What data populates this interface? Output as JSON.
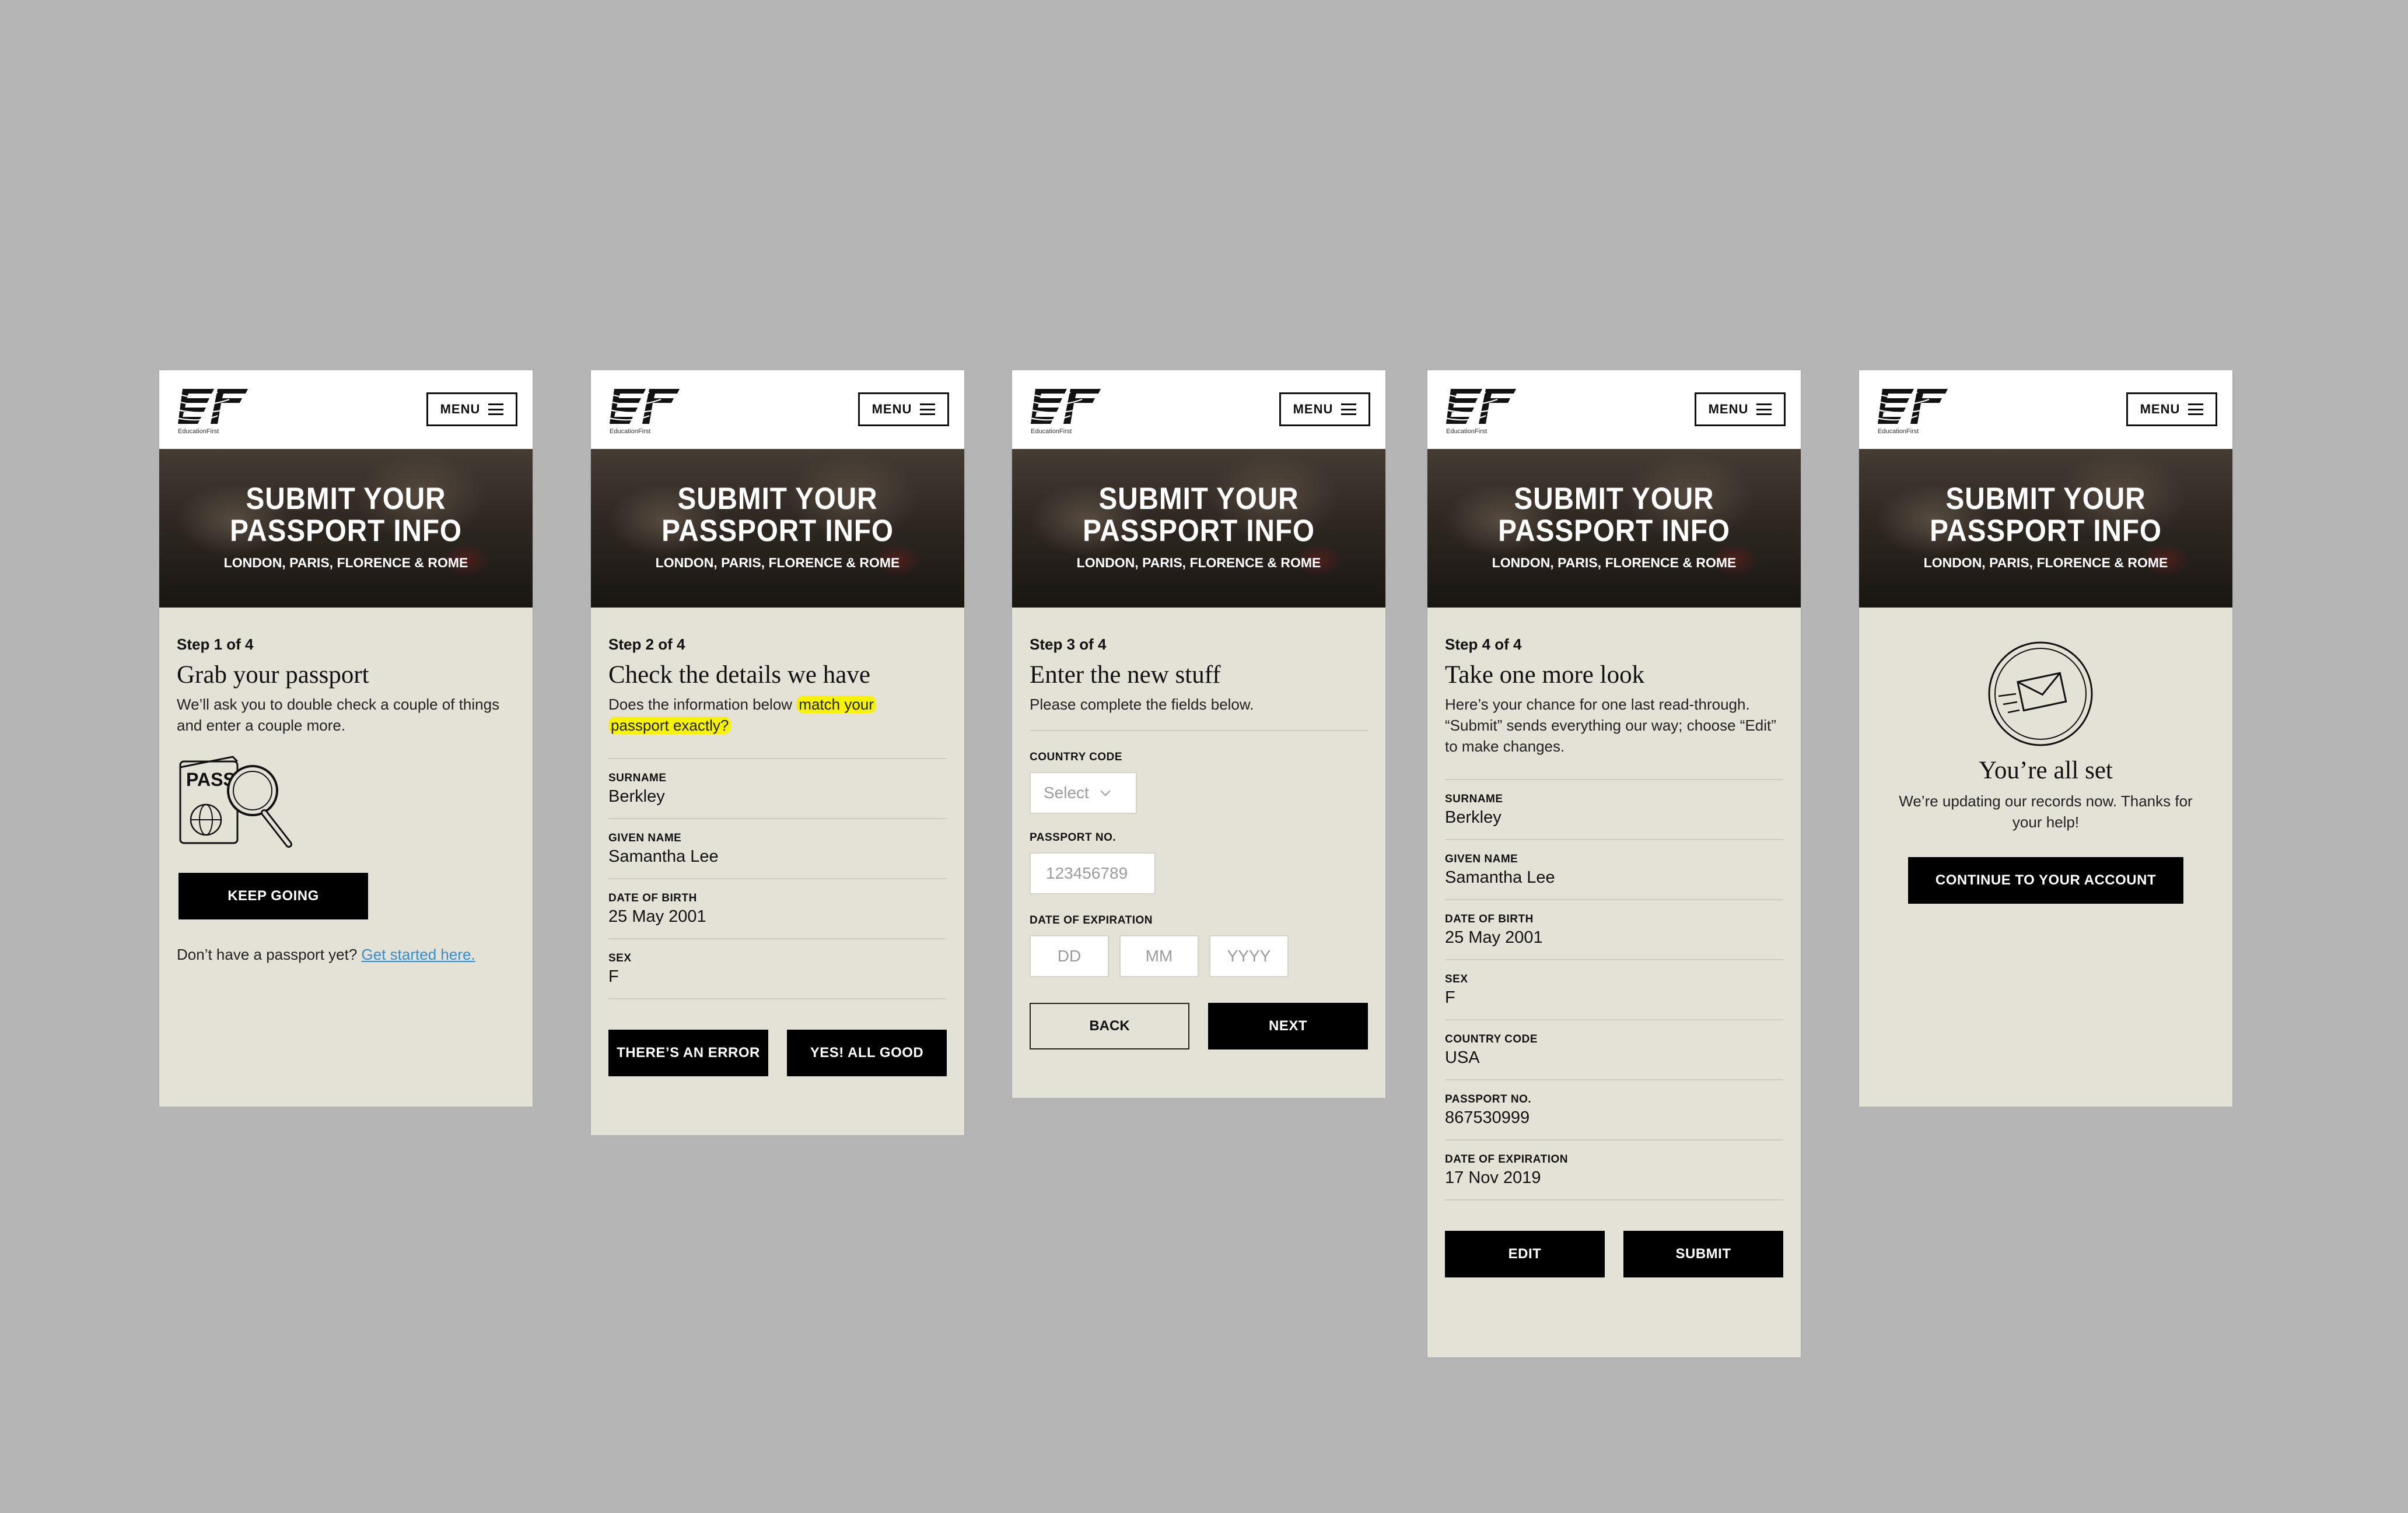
{
  "brand": {
    "logo_text": "EducationFirst",
    "menu_label": "MENU"
  },
  "hero": {
    "title_line1": "SUBMIT YOUR",
    "title_line2": "PASSPORT INFO",
    "subtitle": "LONDON, PARIS, FLORENCE & ROME"
  },
  "screens": {
    "s1": {
      "step": "Step 1 of 4",
      "heading": "Grab your passport",
      "desc": "We’ll ask you to double check a couple of things and enter a couple more.",
      "illustration_text": "PASS",
      "button": "KEEP GOING",
      "footer_text": "Don’t have a passport yet?",
      "footer_link": "Get started here."
    },
    "s2": {
      "step": "Step 2 of 4",
      "heading": "Check the details we have",
      "desc_plain": "Does the information below",
      "desc_highlight1": "match your",
      "desc_highlight2": "passport exactly?",
      "fields": [
        {
          "label": "SURNAME",
          "value": "Berkley"
        },
        {
          "label": "GIVEN NAME",
          "value": "Samantha Lee"
        },
        {
          "label": "DATE OF BIRTH",
          "value": "25 May 2001"
        },
        {
          "label": "SEX",
          "value": "F"
        }
      ],
      "btn_error": "THERE’S AN ERROR",
      "btn_good": "YES! ALL GOOD"
    },
    "s3": {
      "step": "Step 3 of 4",
      "heading": "Enter the new stuff",
      "desc": "Please complete the fields below.",
      "country_label": "COUNTRY CODE",
      "country_placeholder": "Select",
      "passport_label": "PASSPORT NO.",
      "passport_placeholder": "123456789",
      "expiry_label": "DATE OF EXPIRATION",
      "dd_placeholder": "DD",
      "mm_placeholder": "MM",
      "yyyy_placeholder": "YYYY",
      "btn_back": "BACK",
      "btn_next": "NEXT"
    },
    "s4": {
      "step": "Step 4 of 4",
      "heading": "Take one more look",
      "desc": "Here’s your chance for one last read-through. “Submit” sends everything our way; choose “Edit” to make changes.",
      "fields": [
        {
          "label": "SURNAME",
          "value": "Berkley"
        },
        {
          "label": "GIVEN NAME",
          "value": "Samantha Lee"
        },
        {
          "label": "DATE OF BIRTH",
          "value": "25 May 2001"
        },
        {
          "label": "SEX",
          "value": "F"
        },
        {
          "label": "COUNTRY CODE",
          "value": "USA"
        },
        {
          "label": "PASSPORT NO.",
          "value": "867530999"
        },
        {
          "label": "DATE OF EXPIRATION",
          "value": "17 Nov 2019"
        }
      ],
      "btn_edit": "EDIT",
      "btn_submit": "SUBMIT"
    },
    "s5": {
      "heading": "You’re all set",
      "desc": "We’re updating our records now. Thanks for your help!",
      "button": "CONTINUE TO YOUR ACCOUNT"
    }
  },
  "colors": {
    "background": "#b5b5b5",
    "card": "#e4e2d7",
    "highlight": "#f7f300",
    "link": "#2f8fd0"
  }
}
